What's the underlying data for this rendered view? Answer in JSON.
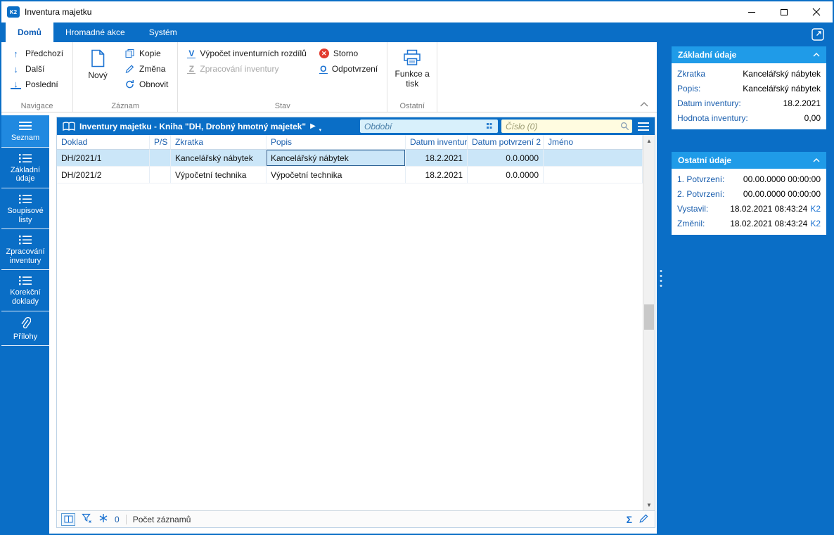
{
  "window": {
    "title": "Inventura majetku"
  },
  "icons": {
    "prev": "↑",
    "next": "↓",
    "last": "↓",
    "play": "▶",
    "play_caret": "▾",
    "scroll_up": "▲",
    "scroll_down": "▼",
    "storno_x": "✕",
    "sigma": "Σ"
  },
  "tabs": [
    {
      "label": "Domů"
    },
    {
      "label": "Hromadné akce"
    },
    {
      "label": "Systém"
    }
  ],
  "ribbon": {
    "navigace": {
      "label": "Navigace",
      "items": [
        {
          "label": "Předchozí"
        },
        {
          "label": "Další"
        },
        {
          "label": "Poslední"
        }
      ]
    },
    "zaznam": {
      "label": "Záznam",
      "big_label": "Nový",
      "items": [
        {
          "label": "Kopie"
        },
        {
          "label": "Změna"
        },
        {
          "label": "Obnovit"
        }
      ]
    },
    "stav": {
      "label": "Stav",
      "items": [
        {
          "label": "Výpočet inventurních rozdílů",
          "letter": "V"
        },
        {
          "label": "Storno"
        },
        {
          "label": "Zpracování inventury",
          "letter": "Z"
        },
        {
          "label": "Odpotvrzení",
          "letter": "O"
        }
      ]
    },
    "ostatni": {
      "label": "Ostatní",
      "big_label": "Funkce a tisk"
    }
  },
  "sidebar": {
    "items": [
      {
        "label": "Seznam"
      },
      {
        "label": "Základní údaje"
      },
      {
        "label": "Soupisové listy"
      },
      {
        "label": "Zpracování inventury"
      },
      {
        "label": "Korekční doklady"
      },
      {
        "label": "Přílohy"
      }
    ]
  },
  "browse": {
    "title": "Inventury majetku - Kniha \"DH, Drobný hmotný majetek\"",
    "period_placeholder": "Období",
    "number_placeholder": "Číslo (0)",
    "columns": [
      "Doklad",
      "P/S",
      "Zkratka",
      "Popis",
      "Datum inventury",
      "Datum potvrzení 2",
      "Jméno"
    ],
    "rows": [
      {
        "doklad": "DH/2021/1",
        "ps": "",
        "zkratka": "Kancelářský nábytek",
        "popis": "Kancelářský nábytek",
        "datum_inventury": "18.2.2021",
        "datum_potvrzeni2": "0.0.0000",
        "jmeno": ""
      },
      {
        "doklad": "DH/2021/2",
        "ps": "",
        "zkratka": "Výpočetní technika",
        "popis": "Výpočetní technika",
        "datum_inventury": "18.2.2021",
        "datum_potvrzeni2": "0.0.0000",
        "jmeno": ""
      }
    ],
    "status": {
      "frozen_count": "0",
      "records_label": "Počet záznamů"
    }
  },
  "panels": {
    "zakladni": {
      "title": "Základní údaje",
      "rows": [
        {
          "label": "Zkratka",
          "value": "Kancelářský nábytek"
        },
        {
          "label": "Popis:",
          "value": "Kancelářský nábytek"
        },
        {
          "label": "Datum inventury:",
          "value": "18.2.2021"
        },
        {
          "label": "Hodnota inventury:",
          "value": "0,00"
        }
      ]
    },
    "ostatni": {
      "title": "Ostatní údaje",
      "rows": [
        {
          "label": "1. Potvrzení:",
          "value": "00.00.0000 00:00:00"
        },
        {
          "label": "2. Potvrzení:",
          "value": "00.00.0000 00:00:00"
        },
        {
          "label": "Vystavil:",
          "value": "18.02.2021 08:43:24",
          "user": "K2"
        },
        {
          "label": "Změnil:",
          "value": "18.02.2021 08:43:24",
          "user": "K2"
        }
      ]
    }
  }
}
